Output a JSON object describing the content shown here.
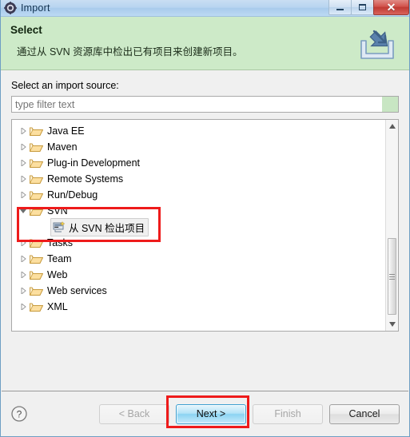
{
  "window": {
    "title": "Import",
    "app_icon": "eclipse-gear-icon",
    "controls": {
      "minimize_label": "Minimize",
      "maximize_label": "Maximize",
      "close_label": "Close"
    }
  },
  "banner": {
    "title": "Select",
    "description": "通过从 SVN 资源库中检出已有项目来创建新项目。",
    "icon": "import-arrow-icon",
    "background_color": "#cdeac8"
  },
  "form": {
    "source_label": "Select an import source:",
    "filter_placeholder": "type filter text",
    "filter_value": "",
    "filter_accent_color": "#c8e6c3"
  },
  "tree": {
    "items": [
      {
        "label": "Java EE",
        "level": 0,
        "expanded": false,
        "icon": "folder-icon",
        "selected": false
      },
      {
        "label": "Maven",
        "level": 0,
        "expanded": false,
        "icon": "folder-icon",
        "selected": false
      },
      {
        "label": "Plug-in Development",
        "level": 0,
        "expanded": false,
        "icon": "folder-icon",
        "selected": false
      },
      {
        "label": "Remote Systems",
        "level": 0,
        "expanded": false,
        "icon": "folder-icon",
        "selected": false
      },
      {
        "label": "Run/Debug",
        "level": 0,
        "expanded": false,
        "icon": "folder-icon",
        "selected": false
      },
      {
        "label": "SVN",
        "level": 0,
        "expanded": true,
        "icon": "folder-icon",
        "selected": false
      },
      {
        "label": "从 SVN 检出项目",
        "level": 1,
        "expanded": null,
        "icon": "svn-checkout-icon",
        "selected": true
      },
      {
        "label": "Tasks",
        "level": 0,
        "expanded": false,
        "icon": "folder-icon",
        "selected": false
      },
      {
        "label": "Team",
        "level": 0,
        "expanded": false,
        "icon": "folder-icon",
        "selected": false
      },
      {
        "label": "Web",
        "level": 0,
        "expanded": false,
        "icon": "folder-icon",
        "selected": false
      },
      {
        "label": "Web services",
        "level": 0,
        "expanded": false,
        "icon": "folder-icon",
        "selected": false
      },
      {
        "label": "XML",
        "level": 0,
        "expanded": false,
        "icon": "folder-icon",
        "selected": false
      }
    ],
    "scrollbar": {
      "up_arrow": "scroll-up-icon",
      "down_arrow": "scroll-down-icon"
    }
  },
  "footer": {
    "help_icon": "help-question-icon",
    "buttons": [
      {
        "label": "< Back",
        "state": "disabled"
      },
      {
        "label": "Next >",
        "state": "default"
      },
      {
        "label": "Finish",
        "state": "disabled"
      },
      {
        "label": "Cancel",
        "state": "enabled"
      }
    ]
  },
  "annotations": {
    "highlight_color": "#ee1b1b",
    "boxes": [
      {
        "target": "svn-tree-branch"
      },
      {
        "target": "next-button"
      }
    ]
  }
}
